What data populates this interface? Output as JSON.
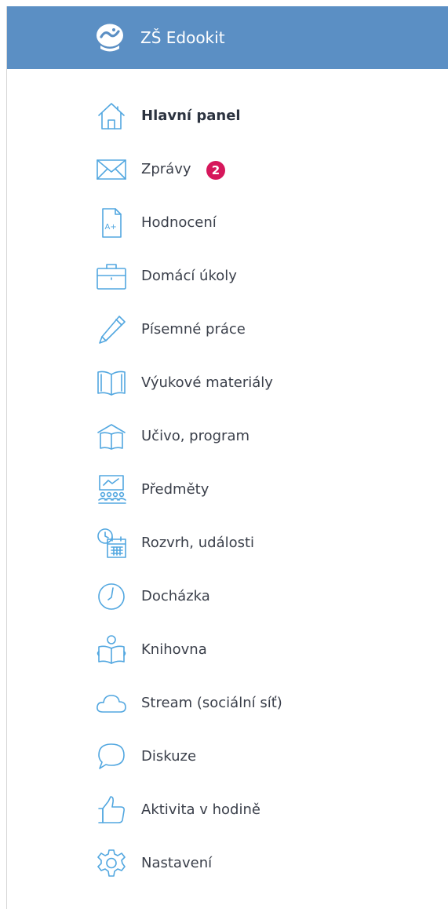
{
  "header": {
    "title": "ZŠ Edookit",
    "logo_icon": "edookit-logo-icon",
    "background_color": "#5b8fc4"
  },
  "menu": {
    "items": [
      {
        "id": "dashboard",
        "label": "Hlavní panel",
        "icon": "home-icon",
        "active": true
      },
      {
        "id": "messages",
        "label": "Zprávy",
        "icon": "envelope-icon",
        "badge": "2"
      },
      {
        "id": "grades",
        "label": "Hodnocení",
        "icon": "grade-document-icon",
        "icon_text": "A+"
      },
      {
        "id": "homework",
        "label": "Domácí úkoly",
        "icon": "briefcase-icon"
      },
      {
        "id": "exams",
        "label": "Písemné práce",
        "icon": "pen-icon"
      },
      {
        "id": "materials",
        "label": "Výukové materiály",
        "icon": "open-book-icon"
      },
      {
        "id": "curriculum",
        "label": "Učivo, program",
        "icon": "book-shelter-icon"
      },
      {
        "id": "subjects",
        "label": "Předměty",
        "icon": "classroom-icon"
      },
      {
        "id": "schedule",
        "label": "Rozvrh, události",
        "icon": "clock-calendar-icon"
      },
      {
        "id": "attendance",
        "label": "Docházka",
        "icon": "clock-icon"
      },
      {
        "id": "library",
        "label": "Knihovna",
        "icon": "reader-icon"
      },
      {
        "id": "stream",
        "label": "Stream (sociální síť)",
        "icon": "cloud-icon"
      },
      {
        "id": "discussion",
        "label": "Diskuze",
        "icon": "speech-bubble-icon"
      },
      {
        "id": "activity",
        "label": "Aktivita v hodině",
        "icon": "thumbs-up-icon"
      },
      {
        "id": "settings",
        "label": "Nastavení",
        "icon": "gear-icon"
      }
    ]
  },
  "colors": {
    "icon": "#52a7e0",
    "badge": "#d6175b",
    "text": "#3a3f4a"
  }
}
